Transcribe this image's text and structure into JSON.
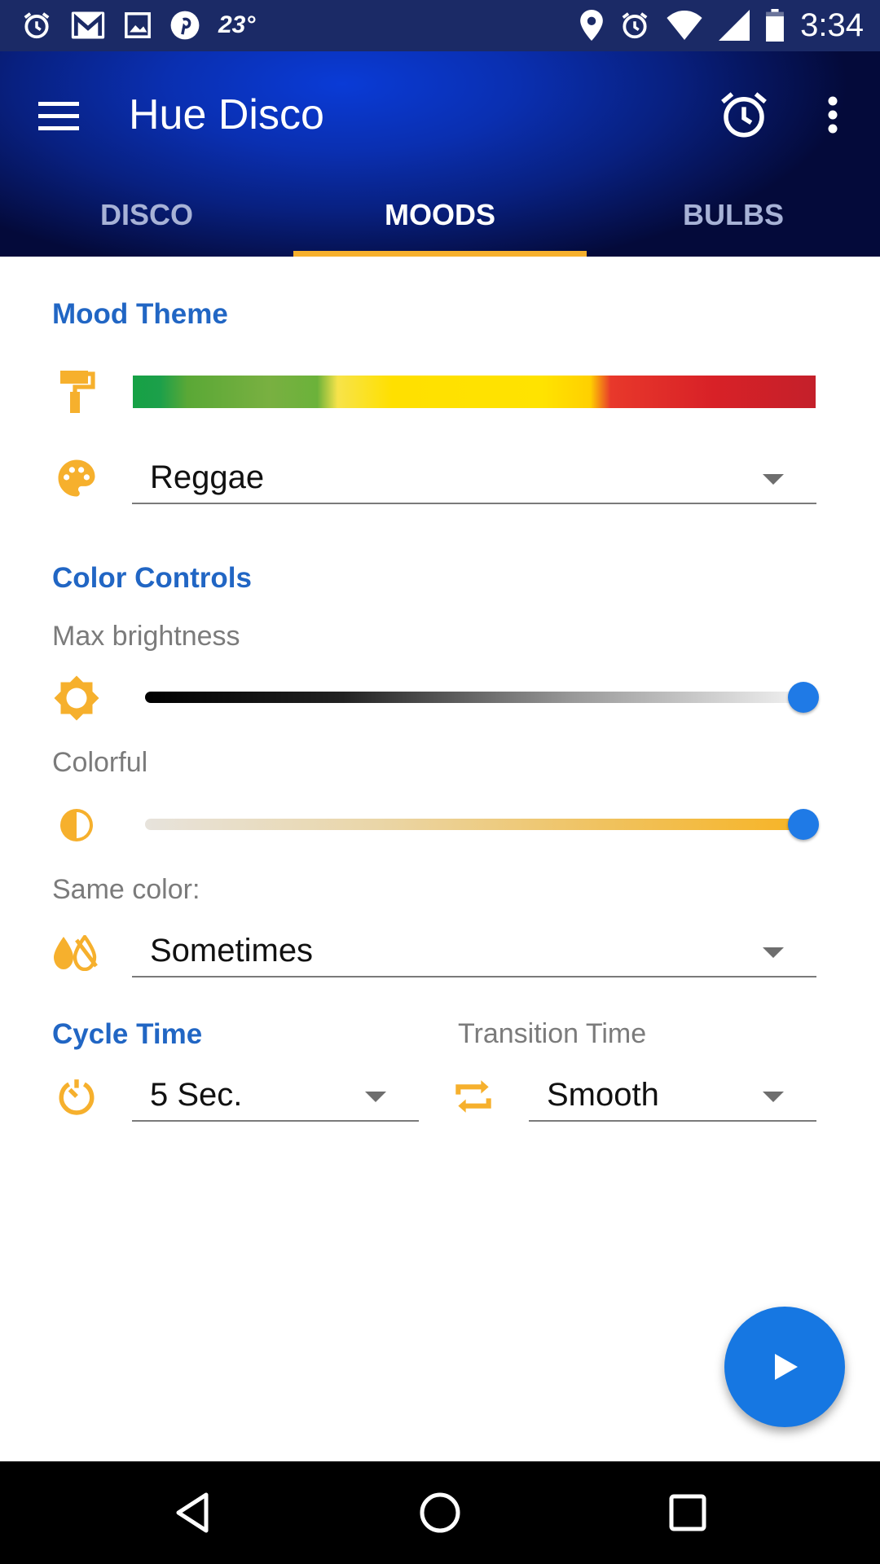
{
  "status_bar": {
    "temperature": "23°",
    "time": "3:34"
  },
  "app_bar": {
    "title": "Hue Disco"
  },
  "tabs": [
    {
      "label": "DISCO",
      "active": false
    },
    {
      "label": "MOODS",
      "active": true
    },
    {
      "label": "BULBS",
      "active": false
    }
  ],
  "mood_theme": {
    "section_title": "Mood Theme",
    "theme_select": "Reggae"
  },
  "color_controls": {
    "section_title": "Color Controls",
    "max_brightness_label": "Max brightness",
    "max_brightness_value": 1.0,
    "colorful_label": "Colorful",
    "colorful_value": 1.0,
    "same_color_label": "Same color:",
    "same_color_select": "Sometimes"
  },
  "cycle_time": {
    "section_title": "Cycle Time",
    "select": "5 Sec."
  },
  "transition_time": {
    "label": "Transition Time",
    "select": "Smooth"
  },
  "colors": {
    "accent_blue": "#2166c4",
    "icon_orange": "#f6b02d",
    "fab_blue": "#1677e2",
    "tab_indicator": "#f6b02d"
  },
  "icons": {
    "paint_roller": "paint-roller-icon",
    "palette": "palette-icon",
    "brightness": "brightness-icon",
    "contrast": "contrast-icon",
    "drops": "invert-colors-icon",
    "timer": "timer-icon",
    "repeat": "repeat-icon",
    "play": "play-icon"
  }
}
